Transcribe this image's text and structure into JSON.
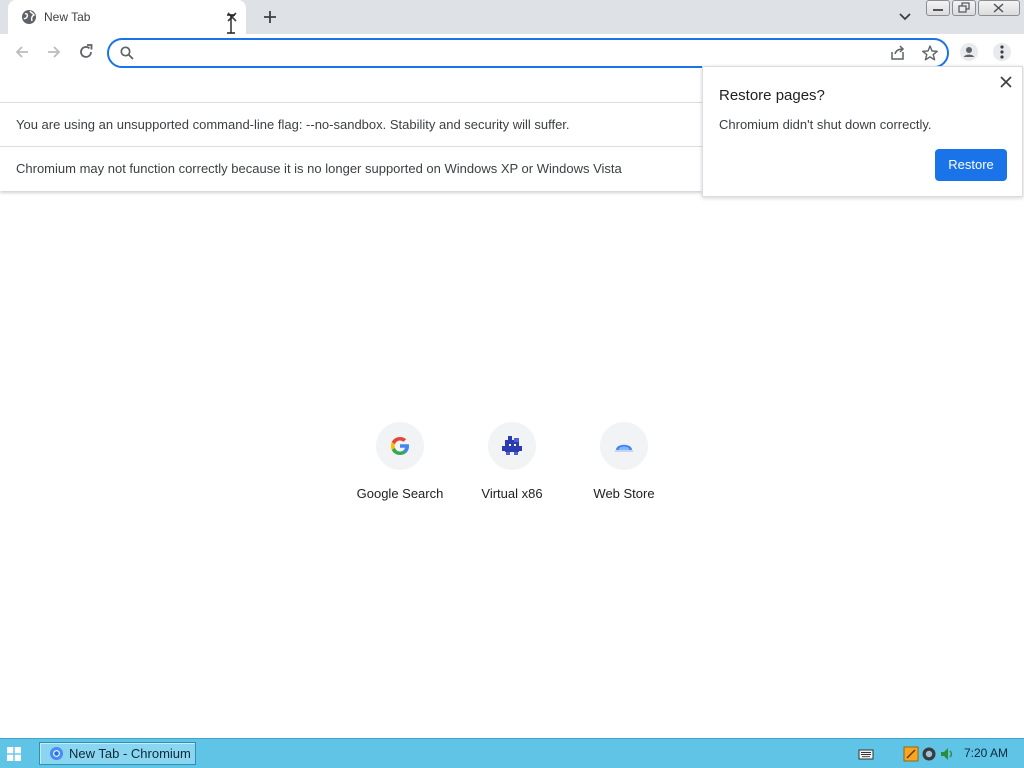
{
  "tab": {
    "title": "New Tab"
  },
  "omnibox": {
    "value": "",
    "placeholder": ""
  },
  "infobars": {
    "sandbox_warning": "You are using an unsupported command-line flag: --no-sandbox. Stability and security will suffer.",
    "os_warning": "Chromium may not function correctly because it is no longer supported on Windows XP or Windows Vista"
  },
  "restore_bubble": {
    "title": "Restore pages?",
    "message": "Chromium didn't shut down correctly.",
    "button_label": "Restore"
  },
  "shortcuts": [
    {
      "label": "Google Search",
      "icon": "google-icon"
    },
    {
      "label": "Virtual x86",
      "icon": "virtual-x86-icon"
    },
    {
      "label": "Web Store",
      "icon": "web-store-icon"
    }
  ],
  "taskbar": {
    "task_label": "New Tab - Chromium",
    "clock": "7:20 AM"
  },
  "colors": {
    "accent": "#1a73e8",
    "tabstrip": "#dee1e6",
    "taskbar": "#5fc4e6"
  }
}
